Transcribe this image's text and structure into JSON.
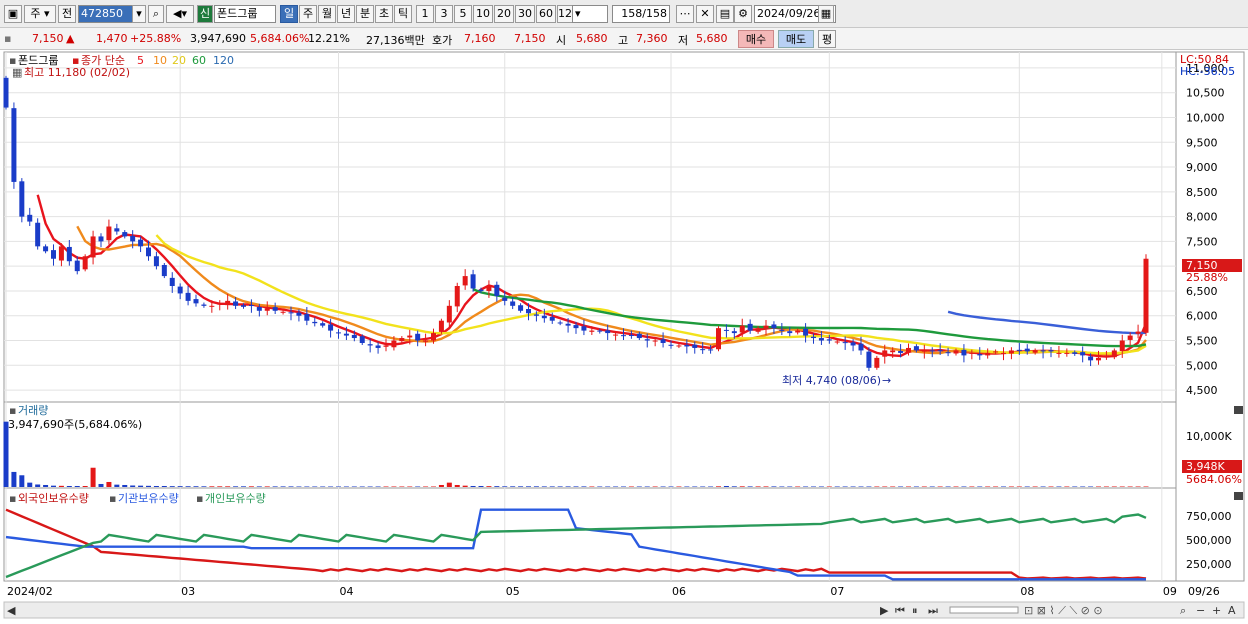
{
  "toolbar": {
    "period_main": "주",
    "prev_label": "전",
    "code": "472850",
    "new_badge": "신",
    "name": "폰드그룹",
    "periods": [
      "일",
      "주",
      "월",
      "년",
      "분",
      "초",
      "틱"
    ],
    "active_period": "일",
    "intervals": [
      "1",
      "3",
      "5",
      "10",
      "20",
      "30",
      "60",
      "120"
    ],
    "count": "158",
    "count_total": "/158",
    "date": "2024/09/26"
  },
  "info": {
    "price": "7,150",
    "change_arrow": "▲",
    "change": "1,470",
    "change_pct": "+25.88%",
    "volume": "3,947,690",
    "volume_ratio": "5,684.06%",
    "turnover": "12.21%",
    "amount": "27,136백만",
    "ask_label": "호가",
    "ask": "7,160",
    "bid": "7,150",
    "open_label": "시",
    "open": "5,680",
    "high_label": "고",
    "high": "7,360",
    "low_label": "저",
    "low": "5,680",
    "buy": "매수",
    "sell": "매도",
    "eval": "평"
  },
  "price_panel": {
    "name": "폰드그룹",
    "ma_label": "종가 단순",
    "ma_periods": [
      "5",
      "10",
      "20",
      "60",
      "120"
    ],
    "ma_colors": [
      "#e8141d",
      "#f08a1c",
      "#f2e21c",
      "#1e9a3c",
      "#3a5fd8"
    ],
    "high_note": "최고 11,180 (02/02)",
    "low_note": "최저 4,740 (08/06)",
    "lc": "LC:50.84",
    "hc": "HC:-36.05",
    "current_price_tag": "7,150",
    "current_pct_tag": "25.88%"
  },
  "volume_panel": {
    "title": "거래량",
    "value_note": "3,947,690주(5,684.06%)",
    "tag_value": "3,948K",
    "tag_pct": "5684.06%"
  },
  "holding_panel": {
    "legend": [
      "외국인보유수량",
      "기관보유수량",
      "개인보유수량"
    ],
    "colors": [
      "#d81818",
      "#2a5ae0",
      "#2a9a5a"
    ]
  },
  "x_axis": {
    "labels": [
      "2024/02",
      "03",
      "04",
      "05",
      "06",
      "07",
      "08",
      "09"
    ],
    "last_label": "09/26"
  },
  "chart_data": [
    {
      "type": "candlestick",
      "title": "폰드그룹",
      "ylim": [
        4300,
        11200
      ],
      "y_ticks": [
        4500,
        5000,
        5500,
        6000,
        6500,
        7000,
        7500,
        8000,
        8500,
        9000,
        9500,
        10000,
        10500,
        11000
      ],
      "close": [
        10200,
        8700,
        8000,
        7900,
        7400,
        7300,
        7150,
        7400,
        7100,
        6900,
        7200,
        7600,
        7500,
        7800,
        7700,
        7600,
        7500,
        7400,
        7200,
        7000,
        6800,
        6600,
        6450,
        6300,
        6250,
        6200,
        6200,
        6250,
        6300,
        6200,
        6180,
        6200,
        6100,
        6150,
        6100,
        6080,
        6050,
        6000,
        5900,
        5850,
        5800,
        5700,
        5650,
        5600,
        5550,
        5450,
        5400,
        5350,
        5400,
        5500,
        5550,
        5600,
        5500,
        5500,
        5650,
        5900,
        6200,
        6600,
        6800,
        6550,
        6500,
        6600,
        6400,
        6300,
        6200,
        6100,
        6050,
        6000,
        5950,
        5900,
        5850,
        5800,
        5750,
        5700,
        5700,
        5680,
        5650,
        5620,
        5600,
        5600,
        5550,
        5500,
        5500,
        5450,
        5400,
        5400,
        5380,
        5350,
        5320,
        5300,
        5750,
        5700,
        5650,
        5800,
        5700,
        5750,
        5800,
        5750,
        5700,
        5650,
        5700,
        5600,
        5550,
        5500,
        5500,
        5480,
        5450,
        5400,
        5300,
        4950,
        5150,
        5300,
        5300,
        5250,
        5350,
        5300,
        5300,
        5280,
        5300,
        5250,
        5300,
        5200,
        5250,
        5200,
        5250,
        5280,
        5250,
        5300,
        5300,
        5280,
        5300,
        5280,
        5280,
        5250,
        5250,
        5230,
        5200,
        5100,
        5150,
        5200,
        5300,
        5500,
        5600,
        5680,
        7150
      ],
      "volume_k": [
        3900,
        900,
        700,
        260,
        150,
        120,
        80,
        70,
        60,
        60,
        60,
        1150,
        180,
        300,
        140,
        120,
        90,
        80,
        70,
        60,
        60,
        50,
        50,
        45,
        45,
        40,
        40,
        40,
        40,
        40,
        40,
        40,
        35,
        35,
        35,
        35,
        35,
        30,
        30,
        30,
        30,
        30,
        30,
        30,
        30,
        30,
        30,
        30,
        30,
        30,
        30,
        30,
        30,
        30,
        30,
        120,
        260,
        120,
        80,
        60,
        60,
        50,
        50,
        40,
        40,
        40,
        40,
        40,
        35,
        35,
        35,
        35,
        35,
        35,
        30,
        30,
        30,
        30,
        30,
        30,
        30,
        30,
        30,
        30,
        30,
        30,
        30,
        30,
        30,
        30,
        40,
        60,
        40,
        40,
        35,
        35,
        35,
        35,
        30,
        30,
        30,
        30,
        30,
        30,
        30,
        30,
        30,
        30,
        30,
        30,
        30,
        30,
        30,
        30,
        30,
        30,
        30,
        30,
        30,
        30,
        30,
        30,
        30,
        30,
        30,
        30,
        30,
        30,
        30,
        30,
        30,
        30,
        30,
        30,
        30,
        30,
        30,
        30,
        30,
        30,
        30,
        30,
        30,
        30,
        30,
        30,
        30,
        30,
        30,
        30,
        30,
        30,
        30,
        30,
        30,
        30,
        80,
        60,
        3948
      ]
    }
  ]
}
